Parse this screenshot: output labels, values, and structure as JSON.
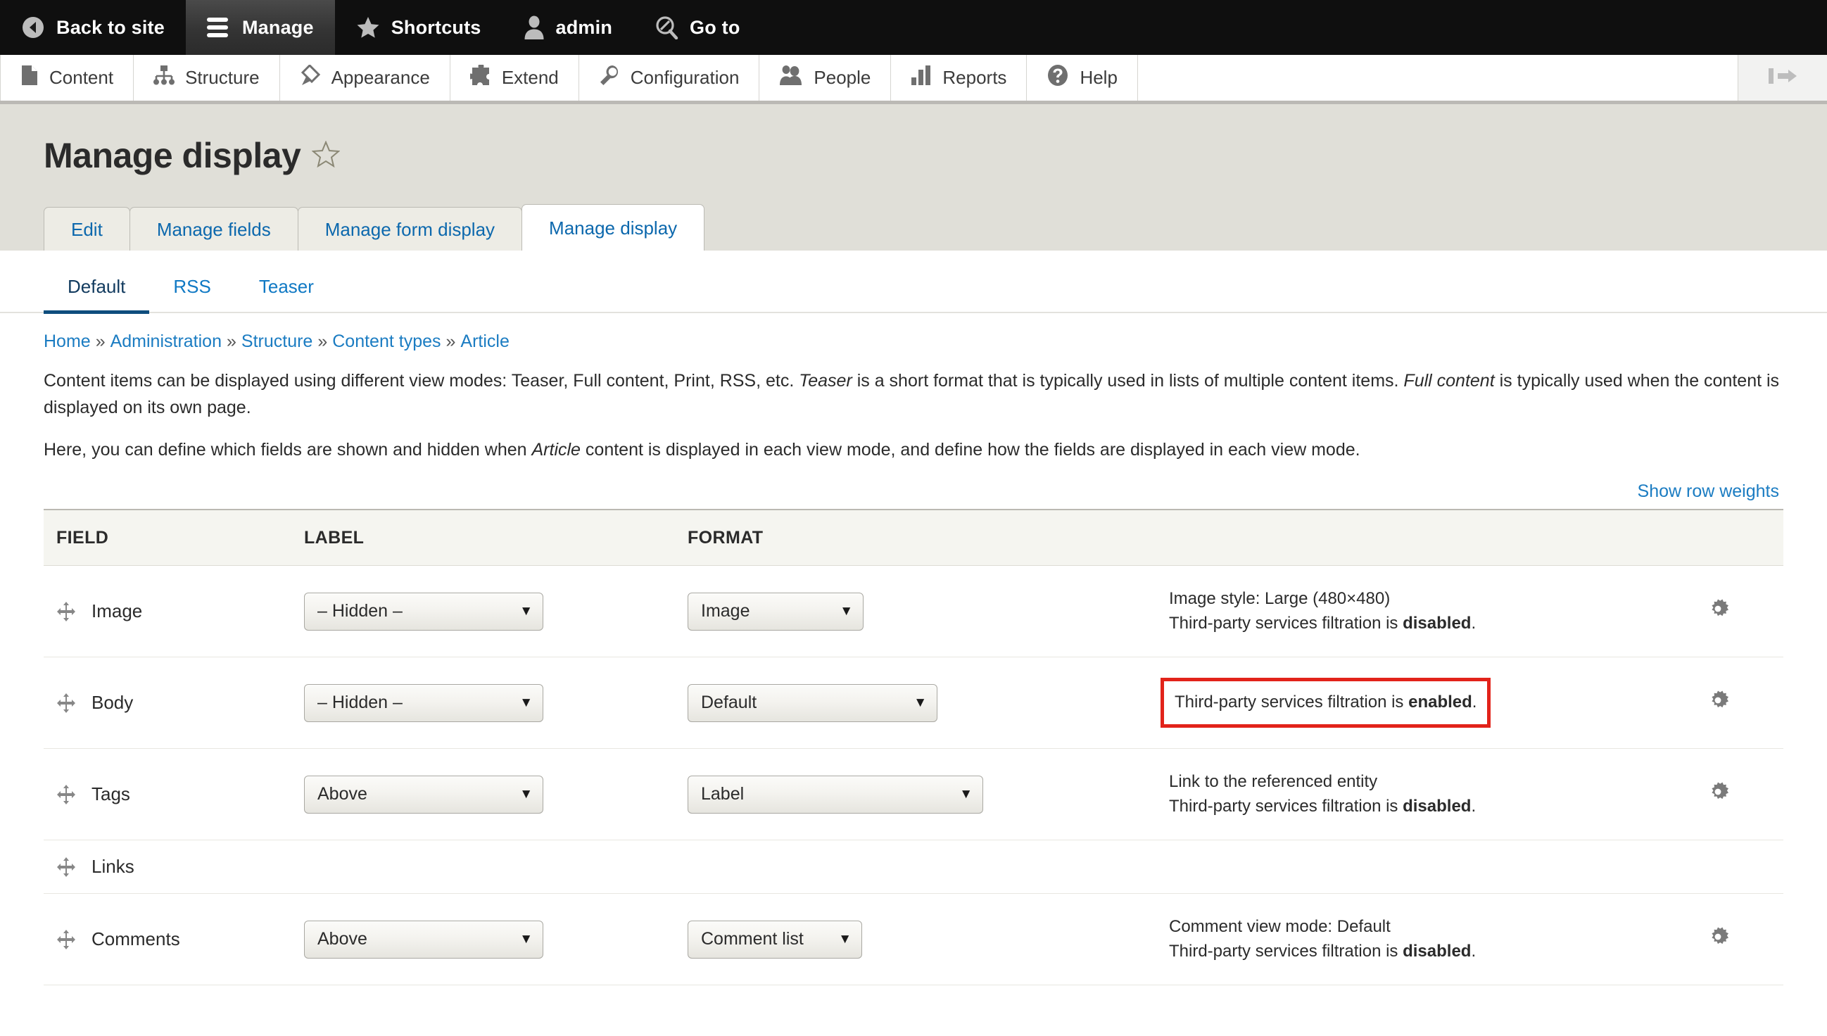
{
  "admin_toolbar": {
    "items": [
      {
        "label": "Back to site",
        "icon": "back-arrow-circle-icon",
        "active": false
      },
      {
        "label": "Manage",
        "icon": "hamburger-icon",
        "active": true
      },
      {
        "label": "Shortcuts",
        "icon": "star-icon",
        "active": false
      },
      {
        "label": "admin",
        "icon": "user-icon",
        "active": false
      },
      {
        "label": "Go to",
        "icon": "magnifier-slash-icon",
        "active": false
      }
    ]
  },
  "menu_bar": {
    "items": [
      {
        "label": "Content",
        "icon": "document-icon"
      },
      {
        "label": "Structure",
        "icon": "sitemap-icon"
      },
      {
        "label": "Appearance",
        "icon": "paintbrush-icon"
      },
      {
        "label": "Extend",
        "icon": "puzzle-piece-icon"
      },
      {
        "label": "Configuration",
        "icon": "wrench-icon"
      },
      {
        "label": "People",
        "icon": "people-icon"
      },
      {
        "label": "Reports",
        "icon": "bar-chart-icon"
      },
      {
        "label": "Help",
        "icon": "question-mark-circle-icon"
      }
    ],
    "toggle_icon": "collapse-toolbar-icon"
  },
  "page": {
    "title": "Manage display",
    "favorite_icon": "star-outline-icon"
  },
  "primary_tabs": [
    {
      "label": "Edit",
      "active": false
    },
    {
      "label": "Manage fields",
      "active": false
    },
    {
      "label": "Manage form display",
      "active": false
    },
    {
      "label": "Manage display",
      "active": true
    }
  ],
  "secondary_tabs": [
    {
      "label": "Default",
      "active": true
    },
    {
      "label": "RSS",
      "active": false
    },
    {
      "label": "Teaser",
      "active": false
    }
  ],
  "breadcrumb": {
    "separator": "»",
    "items": [
      {
        "label": "Home"
      },
      {
        "label": "Administration"
      },
      {
        "label": "Structure"
      },
      {
        "label": "Content types"
      },
      {
        "label": "Article"
      }
    ]
  },
  "intro": {
    "p1_a": "Content items can be displayed using different view modes: Teaser, Full content, Print, RSS, etc. ",
    "p1_em1": "Teaser",
    "p1_b": " is a short format that is typically used in lists of multiple content items. ",
    "p1_em2": "Full content",
    "p1_c": " is typically used when the content is displayed on its own page.",
    "p2_a": "Here, you can define which fields are shown and hidden when ",
    "p2_em1": "Article",
    "p2_b": " content is displayed in each view mode, and define how the fields are displayed in each view mode."
  },
  "show_row_weights": "Show row weights",
  "table": {
    "headers": {
      "field": "FIELD",
      "label": "LABEL",
      "format": "FORMAT",
      "summary": "",
      "gear": ""
    },
    "rows": [
      {
        "field": "Image",
        "label_select": "– Hidden –",
        "format_select": "Image",
        "summary_line1": "Image style: Large (480×480)",
        "summary_prefix": "Third-party services filtration is ",
        "summary_strong": "disabled",
        "summary_suffix": ".",
        "highlighted": false,
        "has_gear": true,
        "has_selects": true
      },
      {
        "field": "Body",
        "label_select": "– Hidden –",
        "format_select": "Default",
        "summary_line1": "",
        "summary_prefix": "Third-party services filtration is ",
        "summary_strong": "enabled",
        "summary_suffix": ".",
        "highlighted": true,
        "has_gear": true,
        "has_selects": true
      },
      {
        "field": "Tags",
        "label_select": "Above",
        "format_select": "Label",
        "summary_line1": "Link to the referenced entity",
        "summary_prefix": "Third-party services filtration is ",
        "summary_strong": "disabled",
        "summary_suffix": ".",
        "highlighted": false,
        "has_gear": true,
        "has_selects": true
      },
      {
        "field": "Links",
        "label_select": "",
        "format_select": "",
        "summary_line1": "",
        "summary_prefix": "",
        "summary_strong": "",
        "summary_suffix": "",
        "highlighted": false,
        "has_gear": false,
        "has_selects": false
      },
      {
        "field": "Comments",
        "label_select": "Above",
        "format_select": "Comment list",
        "summary_line1": "Comment view mode: Default",
        "summary_prefix": "Third-party services filtration is ",
        "summary_strong": "disabled",
        "summary_suffix": ".",
        "highlighted": false,
        "has_gear": true,
        "has_selects": true
      }
    ]
  },
  "colors": {
    "toolbar_bg": "#0f0f0f",
    "page_head_bg": "#e0dfd8",
    "link_blue": "#1b7cc2",
    "active_tab_text": "#113a5e",
    "highlight_red": "#e2231a"
  }
}
